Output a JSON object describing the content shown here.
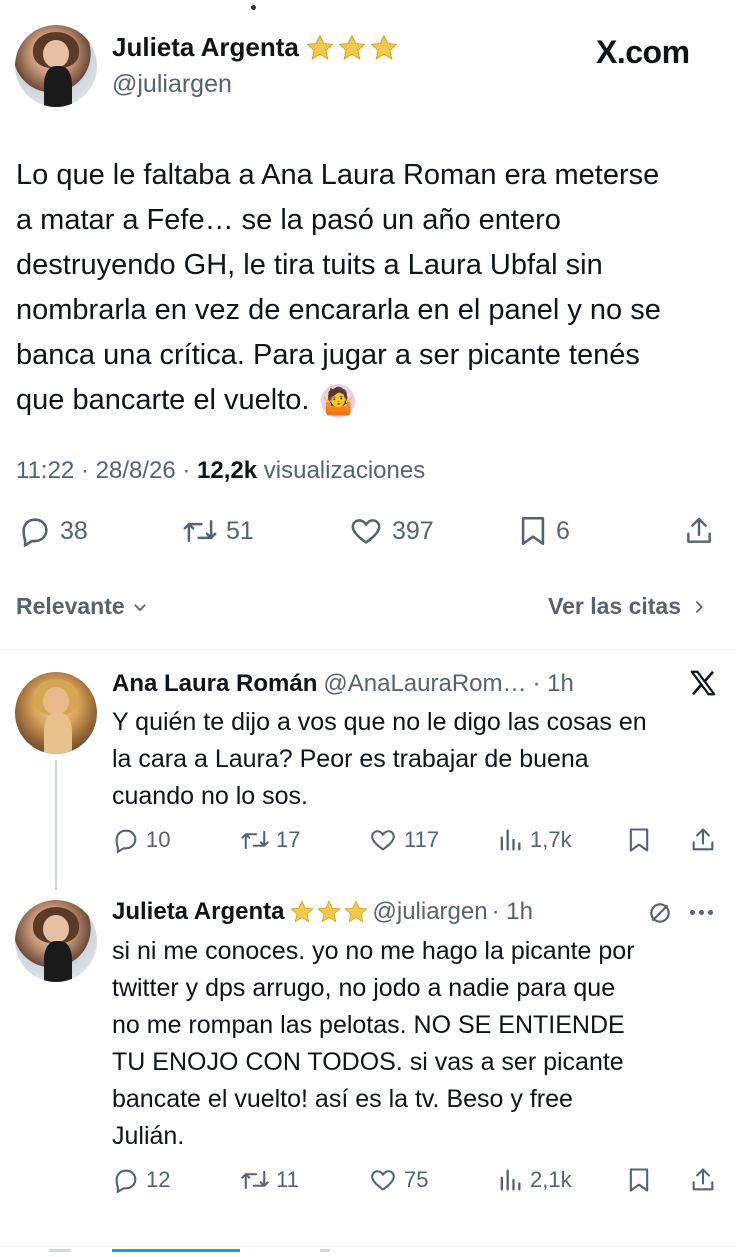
{
  "header": {
    "name": "Julieta Argenta",
    "handle": "@juliargen",
    "brand": "X.com"
  },
  "tweet": {
    "text": "Lo que le faltaba a Ana Laura Roman era meterse a matar a Fefe… se la pasó un año entero destruyendo GH, le tira tuits a Laura Ubfal sin nombrarla en vez de encararla en el panel y no se banca una crítica. Para jugar a ser picante tenés que bancarte el vuelto. 🤷🏻‍♀️",
    "lines": [
      "Lo que le faltaba a Ana Laura Roman era meterse",
      "a matar a Fefe… se la pasó un año entero",
      "destruyendo GH, le tira tuits a Laura Ubfal sin",
      "nombrarla en vez de encararla en el panel y no se",
      "banca una crítica. Para jugar a ser picante tenés",
      "que bancarte el vuelto."
    ],
    "emoji": "🤷",
    "time": "11:22",
    "date": "28/8/26",
    "views": "12,2k",
    "views_label": "visualizaciones",
    "replies": "38",
    "reposts": "51",
    "likes": "397",
    "bookmarks": "6"
  },
  "filters": {
    "sort_label": "Relevante",
    "quotes_label": "Ver las citas"
  },
  "replies": [
    {
      "name": "Ana Laura Román",
      "handle": "@AnaLauraRom…",
      "time": "· 1h",
      "lines": [
        "Y quién te dijo a vos que no le digo las cosas en",
        "la cara a Laura?  Peor es trabajar de buena",
        "cuando no lo sos."
      ],
      "replies": "10",
      "reposts": "17",
      "likes": "117",
      "views": "1,7k"
    },
    {
      "name": "Julieta Argenta",
      "handle": "@juliargen",
      "time": "· 1h",
      "lines": [
        "si ni me conoces. yo no me hago la picante por",
        "twitter y dps arrugo, no jodo a nadie para que",
        "no me rompan las pelotas. NO SE ENTIENDE",
        "TU ENOJO CON TODOS. si vas a ser picante",
        "bancate el vuelto! así es la tv. Beso y free",
        "Julián."
      ],
      "replies": "12",
      "reposts": "11",
      "likes": "75",
      "views": "2,1k"
    }
  ],
  "colors": {
    "text": "#0f1419",
    "secondary": "#536471",
    "divider": "#eff3f4",
    "star": "#f7c948"
  }
}
